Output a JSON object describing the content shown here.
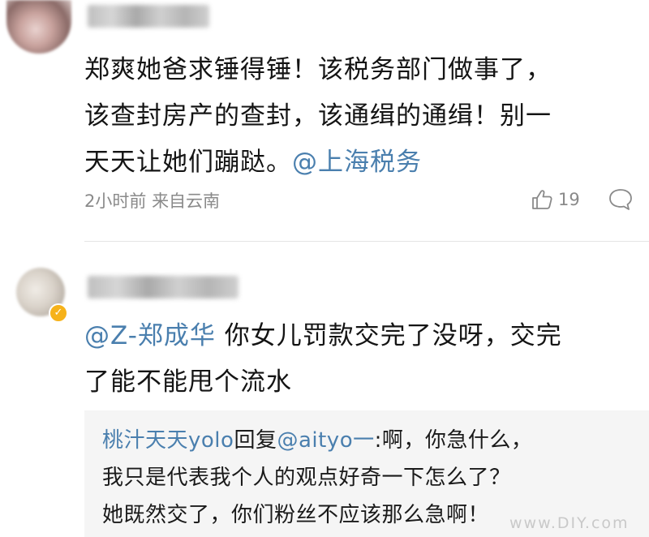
{
  "comments": [
    {
      "text_line1": "郑爽她爸求锤得锤！该税务部门做事了，",
      "text_line2": "该查封房产的查封，该通缉的通缉！别一",
      "text_line3_prefix": "天天让她们蹦跶。",
      "mention": "@上海税务",
      "time": "2小时前",
      "source": "来自云南",
      "likes": "19"
    },
    {
      "mention": "@Z-郑成华",
      "text_line1_suffix": " 你女儿罚款交完了没呀，交完",
      "text_line2": "了能不能甩个流水",
      "reply": {
        "author": "桃汁天天yolo",
        "reply_word": "回复",
        "target": "@aityo一",
        "line1_suffix": ":啊，你急什么，",
        "line2": "我只是代表我个人的观点好奇一下怎么了？",
        "line3": "她既然交了，你们粉丝不应该那么急啊！"
      }
    }
  ],
  "badge_glyph": "✓",
  "watermark": "www.DIY.com",
  "colors": {
    "mention": "#4a7fae",
    "meta": "#8a8a8a",
    "reply_bg": "#f5f5f5",
    "badge": "#f6b21a"
  },
  "icons": [
    "thumbs-up-icon",
    "comment-bubble-icon",
    "verified-badge-icon"
  ]
}
